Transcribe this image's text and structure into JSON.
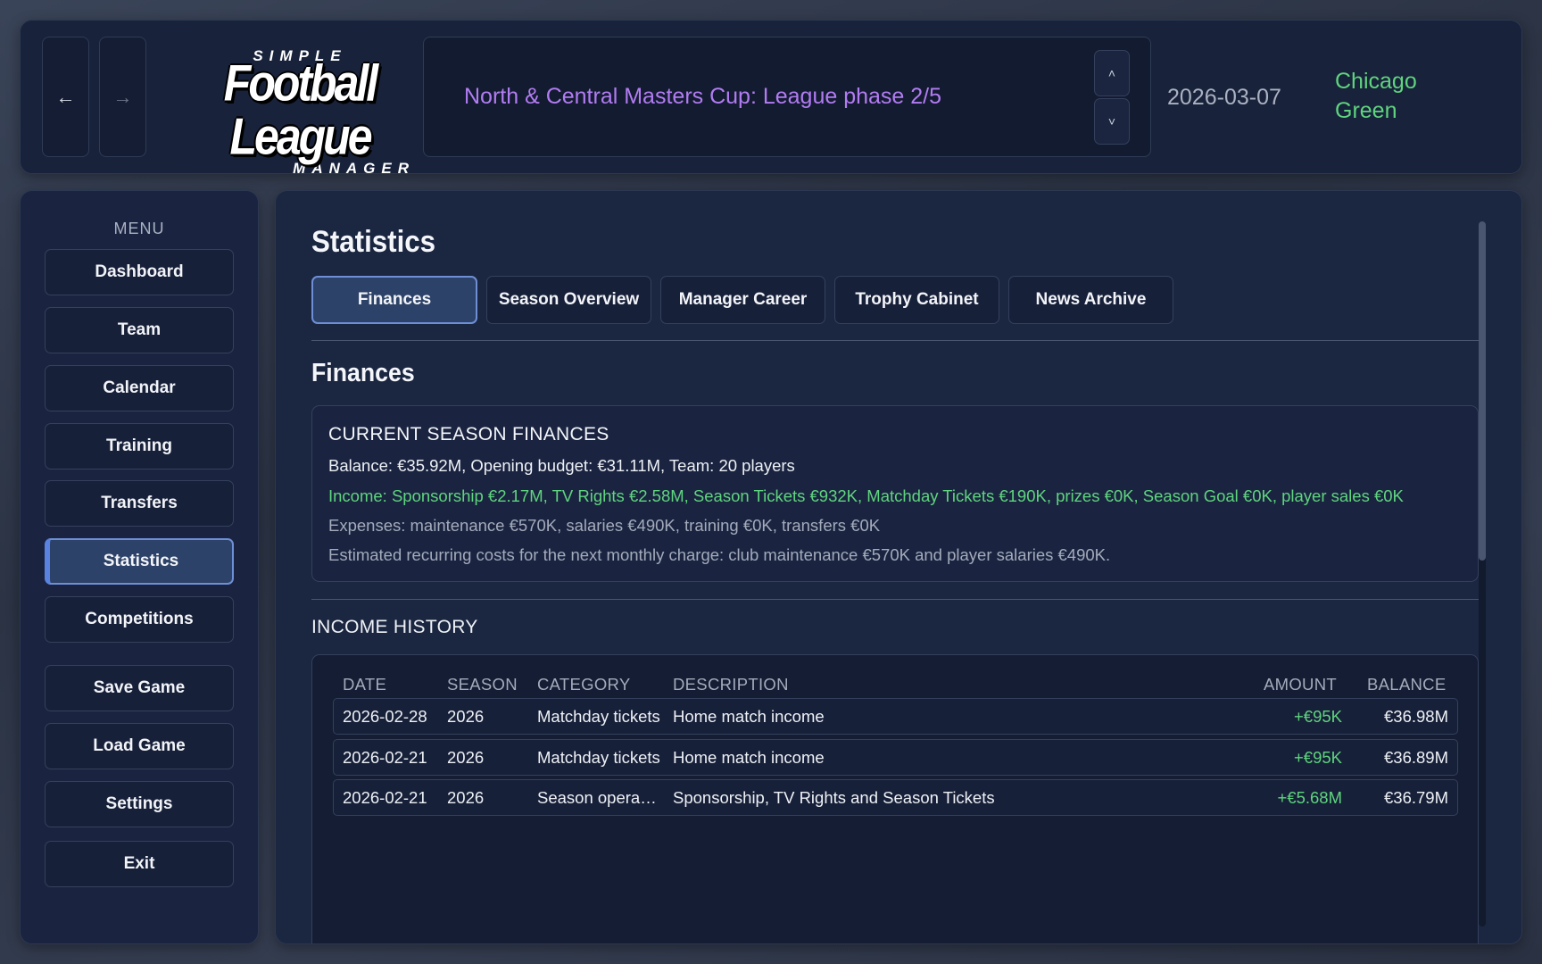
{
  "header": {
    "back_icon": "←",
    "forward_icon": "→",
    "logo": {
      "top": "SIMPLE",
      "middle": "Football League",
      "bottom": "MANAGER"
    },
    "competition": "North & Central Masters Cup: League phase 2/5",
    "scroll_up_icon": "˄",
    "scroll_down_icon": "˅",
    "date": "2026-03-07",
    "club": "Chicago Green"
  },
  "sidebar": {
    "menu_label": "MENU",
    "items": [
      {
        "label": "Dashboard"
      },
      {
        "label": "Team"
      },
      {
        "label": "Calendar"
      },
      {
        "label": "Training"
      },
      {
        "label": "Transfers"
      },
      {
        "label": "Statistics",
        "active": true
      },
      {
        "label": "Competitions"
      },
      {
        "label": "Save Game"
      },
      {
        "label": "Load Game"
      },
      {
        "label": "Settings"
      },
      {
        "label": "Exit"
      }
    ]
  },
  "main": {
    "title": "Statistics",
    "tabs": [
      {
        "label": "Finances",
        "active": true
      },
      {
        "label": "Season Overview"
      },
      {
        "label": "Manager Career"
      },
      {
        "label": "Trophy Cabinet"
      },
      {
        "label": "News Archive"
      }
    ],
    "section_title": "Finances",
    "current_finances": {
      "heading": "CURRENT SEASON FINANCES",
      "balance_line": "Balance: €35.92M, Opening budget: €31.11M, Team: 20 players",
      "income_line": "Income: Sponsorship €2.17M, TV Rights €2.58M, Season Tickets €932K, Matchday Tickets €190K, prizes €0K, Season Goal €0K, player sales €0K",
      "expenses_line": "Expenses: maintenance €570K, salaries €490K, training €0K, transfers €0K",
      "estimate_line": "Estimated recurring costs for the next monthly charge: club maintenance €570K and player salaries €490K."
    },
    "income_history": {
      "title": "INCOME HISTORY",
      "columns": {
        "date": "DATE",
        "season": "SEASON",
        "category": "CATEGORY",
        "description": "DESCRIPTION",
        "amount": "AMOUNT",
        "balance": "BALANCE"
      },
      "rows": [
        {
          "date": "2026-02-28",
          "season": "2026",
          "category": "Matchday tickets",
          "description": "Home match income",
          "amount": "+€95K",
          "balance": "€36.98M"
        },
        {
          "date": "2026-02-21",
          "season": "2026",
          "category": "Matchday tickets",
          "description": "Home match income",
          "amount": "+€95K",
          "balance": "€36.89M"
        },
        {
          "date": "2026-02-21",
          "season": "2026",
          "category": "Season opera…",
          "description": "Sponsorship, TV Rights and Season Tickets",
          "amount": "+€5.68M",
          "balance": "€36.79M"
        }
      ]
    }
  },
  "colors": {
    "accent_purple": "#b27cf2",
    "positive_green": "#5fd47e",
    "active_border": "#6e8fd6",
    "panel_bg": "#1b2641"
  }
}
